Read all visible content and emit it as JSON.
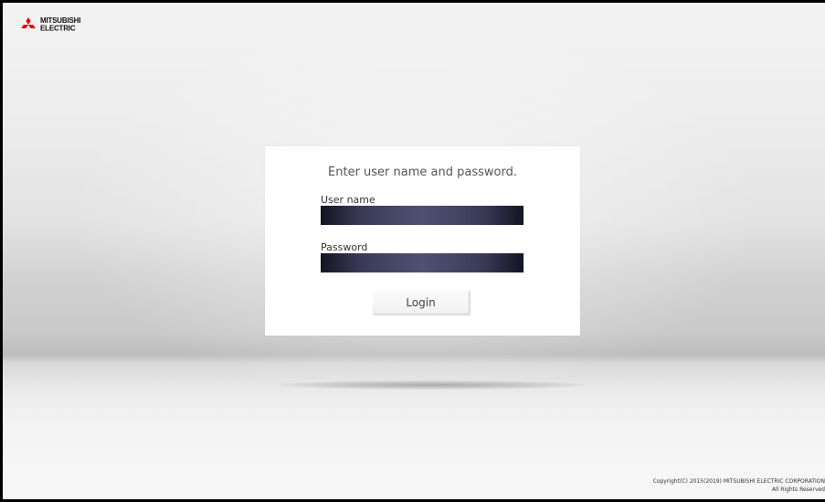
{
  "brand": {
    "name_line1": "MITSUBISHI",
    "name_line2": "ELECTRIC",
    "logo_icon": "three-diamonds-icon",
    "logo_color": "#e60012"
  },
  "login": {
    "title": "Enter user name and password.",
    "username_label": "User name",
    "username_value": "",
    "password_label": "Password",
    "password_value": "",
    "button_label": "Login"
  },
  "footer": {
    "copyright_line1": "Copyright(C) 2015(2019) MITSUBISHI ELECTRIC CORPORATION",
    "copyright_line2": "All Rights Reserved"
  }
}
